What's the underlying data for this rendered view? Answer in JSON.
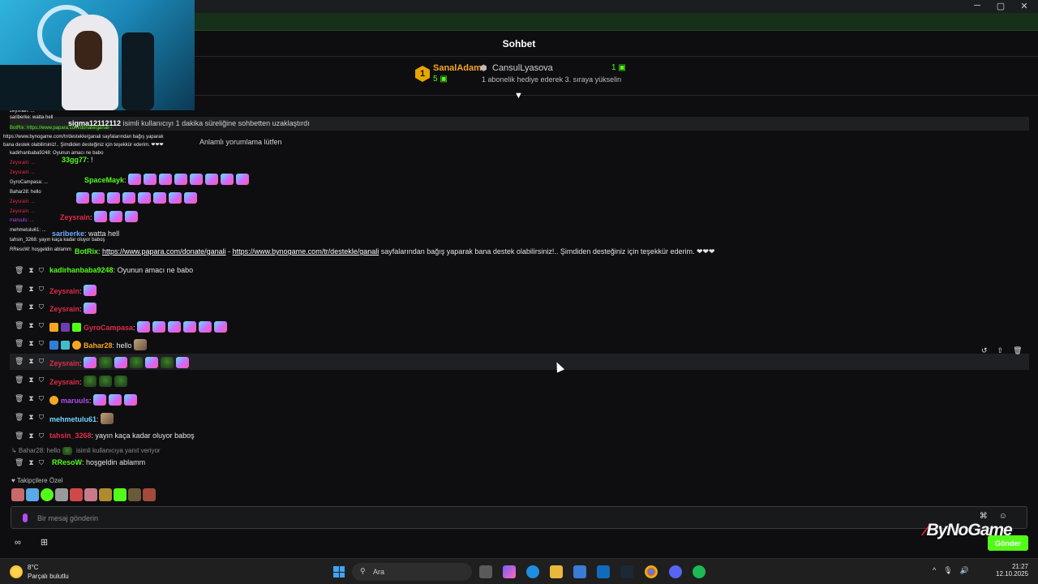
{
  "window": {
    "minimize": "─",
    "maximize": "▢",
    "close": "✕"
  },
  "chat": {
    "title": "Sohbet"
  },
  "leaderboard": {
    "first": {
      "rank": "1",
      "name": "SanalAdam",
      "count": "5 ▣"
    },
    "second": {
      "name": "CansulLyasova",
      "hint": "1 abonelik hediye ederek 3. sıraya yükselin",
      "count": "1 ▣"
    }
  },
  "mod_notice": {
    "text": "isimli kullanıcıyı 1 dakika süreliğine sohbetten uzaklaştırdı",
    "target": "sigma12112112"
  },
  "pinned_text": "Anlamlı yorumlama lütfen",
  "messages": [
    {
      "user": "33gg77",
      "color": "#53fc18",
      "text": "!"
    },
    {
      "user": "SpaceMayk",
      "color": "#53fc18",
      "text": ""
    },
    {
      "user": "Zeysrain",
      "color": "#e02b4a",
      "text": ""
    },
    {
      "user": "Zeysrain",
      "color": "#e02b4a",
      "text": ""
    },
    {
      "user": "sariberke",
      "color": "#6fa8ff",
      "text": "watta hell"
    },
    {
      "user": "BotRix",
      "color": "#53fc18",
      "link1": "https://www.papara.com/donate/ganali",
      "sep": "-",
      "link2": "https://www.bynogame.com/tr/destekle/ganali",
      "text": "sayfalarından bağış yaparak bana destek olabilirsiniz!.. Şimdiden desteğiniz için teşekkür ederim. ❤❤❤"
    },
    {
      "user": "kadirhanbaba9248",
      "color": "#53fc18",
      "text": "Oyunun amacı ne babo"
    },
    {
      "user": "Zeysrain",
      "color": "#e02b4a",
      "text": ""
    },
    {
      "user": "Zeysrain",
      "color": "#e02b4a",
      "text": ""
    },
    {
      "user": "GyroCampasa",
      "color": "#e02b4a",
      "text": ""
    },
    {
      "user": "Bahar28",
      "color": "#f5a623",
      "text": "hello"
    },
    {
      "user": "Zeysrain",
      "color": "#e02b4a",
      "text": ""
    },
    {
      "user": "Zeysrain",
      "color": "#e02b4a",
      "text": ""
    },
    {
      "user": "maruuls",
      "color": "#b44cf0",
      "text": ""
    },
    {
      "user": "mehmetulu61",
      "color": "#75d5ff",
      "text": ""
    },
    {
      "user": "tahsin_3268",
      "color": "#e02b4a",
      "text": "yayın kaça kadar oluyor baboş"
    },
    {
      "user": "RResoW",
      "color": "#53fc18",
      "text": "hoşgeldin ablamm"
    }
  ],
  "reply_note": {
    "prefix": "↳ Bahar28: hello",
    "text": "isimli kullanıcıya yanıt veriyor"
  },
  "overlay_lines": [
    "zeysrain: ...",
    "sariberke: watta hell",
    "BotRix: https://www.papara.com/donate/ganali -",
    "https://www.bynogame.com/tr/destekle/ganali sayfalarından bağış yaparak",
    "bana destek olabilirsiniz!.. Şimdiden desteğiniz için teşekkür ederim. ❤❤❤",
    "kadirhanbaba9248: Oyunun amacı ne babo",
    "Zeysrain: ...",
    "Zeysrain: ...",
    "GyroCampasa: ...",
    "Bahar28: hello",
    "Zeysrain: ...",
    "Zeysrain: ...",
    "maruuls: ...",
    "mehmetulu61: ...",
    "tahsin_3268: yayın kaça kadar oluyor baboş",
    "RResoW: hoşgeldin ablamm"
  ],
  "followers_label": "♥ Takipçilere Özel",
  "input": {
    "placeholder": "Bir mesaj gönderin",
    "send": "Gönder"
  },
  "logo": {
    "mark": "⁄",
    "text": "ByNoGame"
  },
  "taskbar": {
    "temp": "8°C",
    "weather": "Parçalı bulutlu",
    "search": "Ara",
    "time": "21:27",
    "date": "12.10.2025"
  }
}
